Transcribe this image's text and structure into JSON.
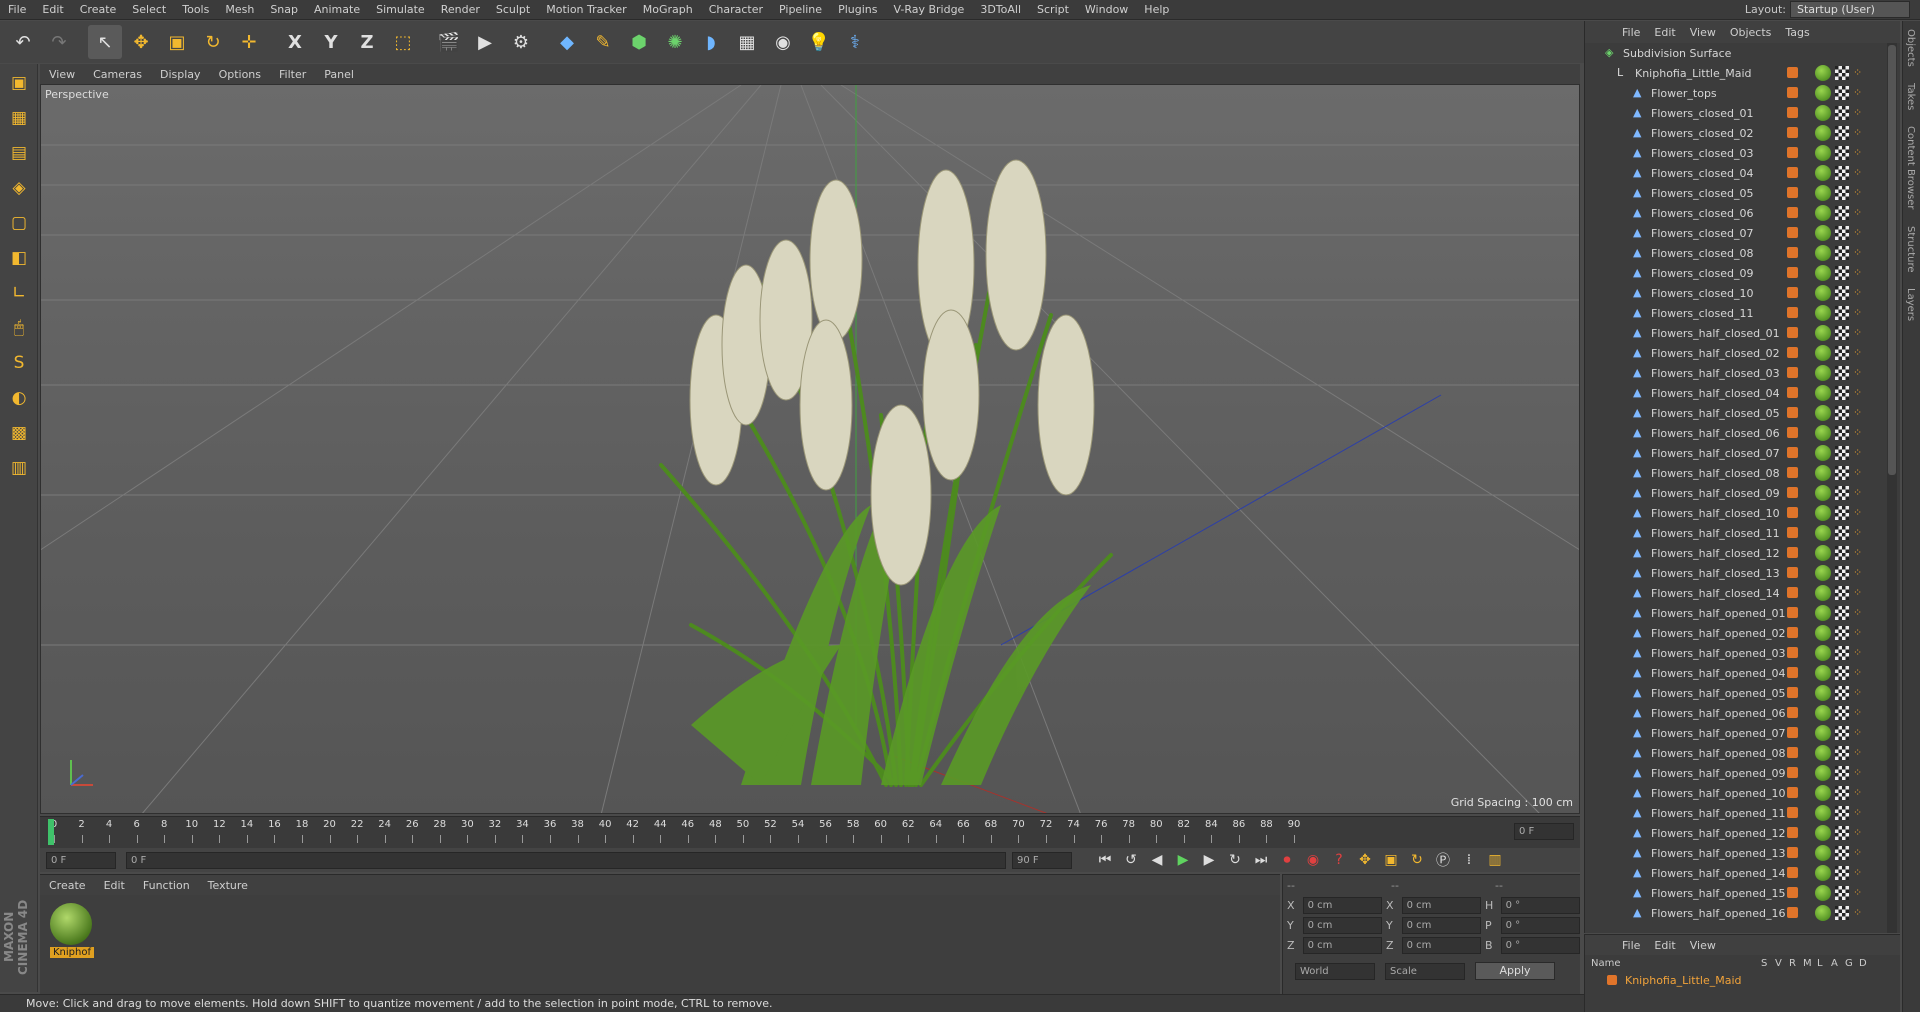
{
  "menu": [
    "File",
    "Edit",
    "Create",
    "Select",
    "Tools",
    "Mesh",
    "Snap",
    "Animate",
    "Simulate",
    "Render",
    "Sculpt",
    "Motion Tracker",
    "MoGraph",
    "Character",
    "Pipeline",
    "Plugins",
    "V-Ray Bridge",
    "3DToAll",
    "Script",
    "Window",
    "Help"
  ],
  "layout": {
    "label": "Layout:",
    "value": "Startup (User)"
  },
  "toolbar": {
    "undo": "↶",
    "redo": "↷",
    "select": "↖",
    "move": "✥",
    "scale": "▣",
    "rotate": "↻",
    "add": "✛",
    "x": "X",
    "y": "Y",
    "z": "Z",
    "coord": "⬚",
    "render": "🎬",
    "render_pv": "▶",
    "render_settings": "⚙",
    "cube": "◆",
    "pen": "✎",
    "nurbs": "⬢",
    "mograph": "✺",
    "deform": "◗",
    "floor": "▦",
    "camera": "◉",
    "light": "💡",
    "python": "⚕"
  },
  "lefttools": [
    "▣",
    "▦",
    "▤",
    "◈",
    "▢",
    "◧",
    "∟",
    "🖱",
    "S",
    "◐",
    "▩",
    "▥"
  ],
  "maxon": "MAXON CINEMA 4D",
  "viewport": {
    "menu": [
      "View",
      "Cameras",
      "Display",
      "Options",
      "Filter",
      "Panel"
    ],
    "label": "Perspective",
    "grid_spacing": "Grid Spacing : 100 cm"
  },
  "timeline": {
    "ticks": [
      "0",
      "2",
      "4",
      "6",
      "8",
      "10",
      "12",
      "14",
      "16",
      "18",
      "20",
      "22",
      "24",
      "26",
      "28",
      "30",
      "32",
      "34",
      "36",
      "38",
      "40",
      "42",
      "44",
      "46",
      "48",
      "50",
      "52",
      "54",
      "56",
      "58",
      "60",
      "62",
      "64",
      "66",
      "68",
      "70",
      "72",
      "74",
      "76",
      "78",
      "80",
      "82",
      "84",
      "86",
      "88",
      "90"
    ],
    "current": "0 F"
  },
  "transport": {
    "start": "0 F",
    "min": "0 F",
    "max": "90 F",
    "end": "90 F"
  },
  "material": {
    "menu": [
      "Create",
      "Edit",
      "Function",
      "Texture"
    ],
    "name": "Kniphof"
  },
  "coords": {
    "rows": [
      {
        "a": "X",
        "av": "0 cm",
        "b": "X",
        "bv": "0 cm",
        "c": "H",
        "cv": "0 °"
      },
      {
        "a": "Y",
        "av": "0 cm",
        "b": "Y",
        "bv": "0 cm",
        "c": "P",
        "cv": "0 °"
      },
      {
        "a": "Z",
        "av": "0 cm",
        "b": "Z",
        "bv": "0 cm",
        "c": "B",
        "cv": "0 °"
      }
    ],
    "mode": "World",
    "scale": "Scale",
    "apply": "Apply",
    "hdr1": "--",
    "hdr2": "--",
    "hdr3": "--"
  },
  "status": "Move: Click and drag to move elements. Hold down SHIFT to quantize movement / add to the selection in point mode, CTRL to remove.",
  "objects": {
    "menu": [
      "File",
      "Edit",
      "View",
      "Objects",
      "Tags"
    ],
    "root": "Subdivision Surface",
    "group": "Kniphofia_Little_Maid",
    "items": [
      "Flower_tops",
      "Flowers_closed_01",
      "Flowers_closed_02",
      "Flowers_closed_03",
      "Flowers_closed_04",
      "Flowers_closed_05",
      "Flowers_closed_06",
      "Flowers_closed_07",
      "Flowers_closed_08",
      "Flowers_closed_09",
      "Flowers_closed_10",
      "Flowers_closed_11",
      "Flowers_half_closed_01",
      "Flowers_half_closed_02",
      "Flowers_half_closed_03",
      "Flowers_half_closed_04",
      "Flowers_half_closed_05",
      "Flowers_half_closed_06",
      "Flowers_half_closed_07",
      "Flowers_half_closed_08",
      "Flowers_half_closed_09",
      "Flowers_half_closed_10",
      "Flowers_half_closed_11",
      "Flowers_half_closed_12",
      "Flowers_half_closed_13",
      "Flowers_half_closed_14",
      "Flowers_half_opened_01",
      "Flowers_half_opened_02",
      "Flowers_half_opened_03",
      "Flowers_half_opened_04",
      "Flowers_half_opened_05",
      "Flowers_half_opened_06",
      "Flowers_half_opened_07",
      "Flowers_half_opened_08",
      "Flowers_half_opened_09",
      "Flowers_half_opened_10",
      "Flowers_half_opened_11",
      "Flowers_half_opened_12",
      "Flowers_half_opened_13",
      "Flowers_half_opened_14",
      "Flowers_half_opened_15",
      "Flowers_half_opened_16"
    ]
  },
  "sidetabs": [
    "Objects",
    "Takes",
    "Content Browser",
    "Structure",
    "Layers"
  ],
  "layers": {
    "menu": [
      "File",
      "Edit",
      "View"
    ],
    "cols": [
      "Name",
      "S",
      "V",
      "R",
      "M",
      "L",
      "A",
      "G",
      "D"
    ],
    "row": "Kniphofia_Little_Maid"
  },
  "colors": {
    "accent": "#f2b82f",
    "object_dot": "#e0742a",
    "layer_name": "#f2a33a"
  }
}
